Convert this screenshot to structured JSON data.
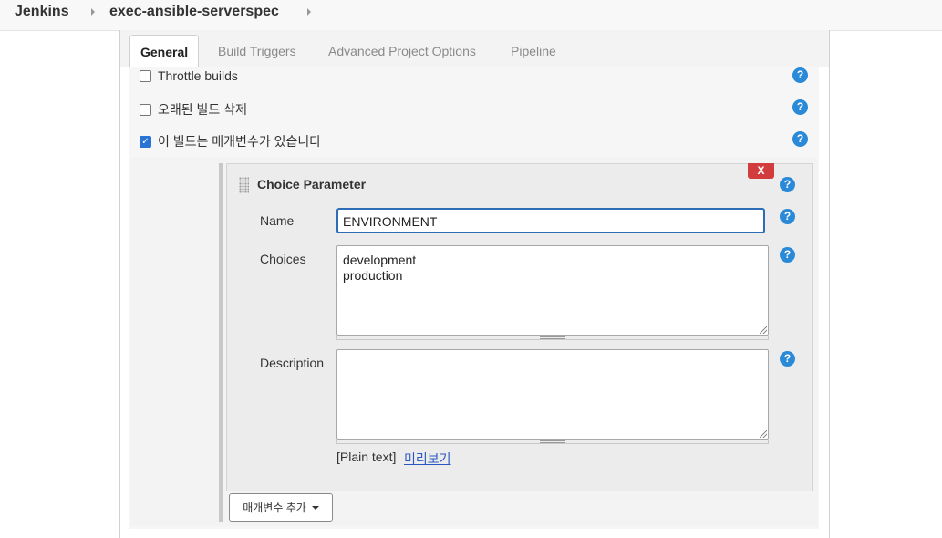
{
  "breadcrumb": {
    "items": [
      "Jenkins",
      "exec-ansible-serverspec"
    ]
  },
  "tabs": [
    {
      "label": "General",
      "active": true
    },
    {
      "label": "Build Triggers",
      "active": false
    },
    {
      "label": "Advanced Project Options",
      "active": false
    },
    {
      "label": "Pipeline",
      "active": false
    }
  ],
  "general": {
    "options": [
      {
        "label": "Throttle builds",
        "checked": false
      },
      {
        "label": "오래된 빌드 삭제",
        "checked": false
      },
      {
        "label": "이 빌드는 매개변수가 있습니다",
        "checked": true
      }
    ]
  },
  "parameter": {
    "title": "Choice Parameter",
    "delete_label": "X",
    "name_label": "Name",
    "name_value": "ENVIRONMENT",
    "choices_label": "Choices",
    "choices_value": "development\nproduction",
    "description_label": "Description",
    "description_value": "",
    "format_note": "[Plain text]",
    "preview_link": "미리보기"
  },
  "add_parameter_button": "매개변수 추가",
  "help_label": "?",
  "check_mark": "✓",
  "colors": {
    "help": "#2a8ad7",
    "delete": "#d23c3c",
    "checkbox_checked": "#2a73d6",
    "link": "#2a57c2",
    "focus_border": "#2d6db5"
  },
  "icons": [
    "chevron-right-icon",
    "help-icon",
    "drag-handle-icon",
    "caret-down-icon",
    "check-icon"
  ]
}
